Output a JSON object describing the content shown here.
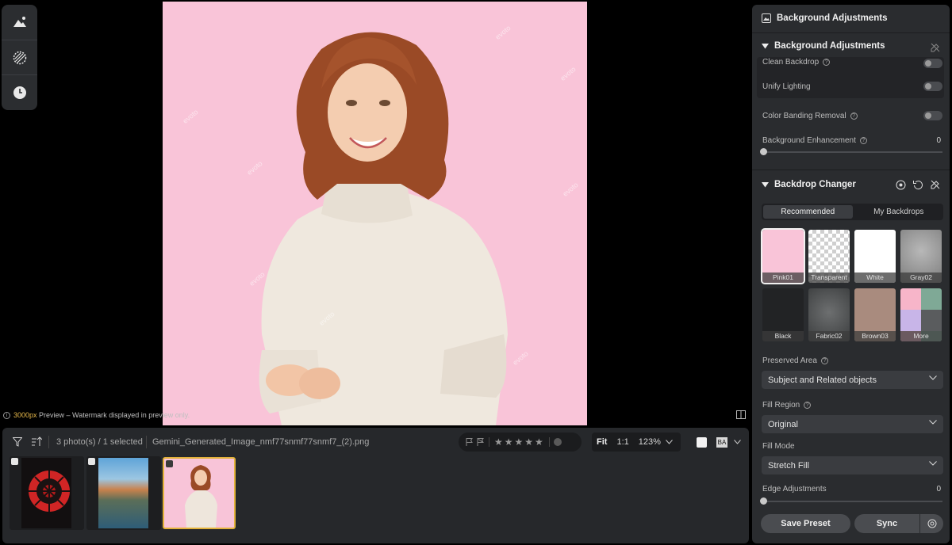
{
  "preview_note": {
    "size": "3000px",
    "text": " Preview – Watermark displayed in preview only."
  },
  "watermark": "evoto",
  "filmstrip": {
    "count_text": "3 photo(s) / 1 selected",
    "filename": "Gemini_Generated_Image_nmf77snmf77snmf7_(2).png",
    "zoom_fit": "Fit",
    "zoom_1to1": "1:1",
    "zoom_level": "123%",
    "rating_stars": 0
  },
  "panel": {
    "title": "Background Adjustments",
    "section1_title": "Background Adjustments",
    "clean_backdrop": "Clean Backdrop",
    "unify_lighting": "Unify Lighting",
    "color_banding": "Color Banding Removal",
    "bg_enhancement": "Background Enhancement",
    "bg_enhancement_value": "0",
    "section2_title": "Backdrop Changer",
    "tab_recommended": "Recommended",
    "tab_my": "My Backdrops",
    "backdrops": [
      "Pink01",
      "Transparent",
      "White",
      "Gray02",
      "Black",
      "Fabric02",
      "Brown03",
      "More"
    ],
    "preserved_area_label": "Preserved Area",
    "preserved_area_value": "Subject and Related objects",
    "fill_region_label": "Fill Region",
    "fill_region_value": "Original",
    "fill_mode_label": "Fill Mode",
    "fill_mode_value": "Stretch Fill",
    "edge_adjustments": "Edge Adjustments",
    "edge_value": "0",
    "save_preset": "Save Preset",
    "sync": "Sync"
  },
  "colors": {
    "accent": "#e3b23a",
    "backdrop_pink": "#f9c4d8"
  }
}
